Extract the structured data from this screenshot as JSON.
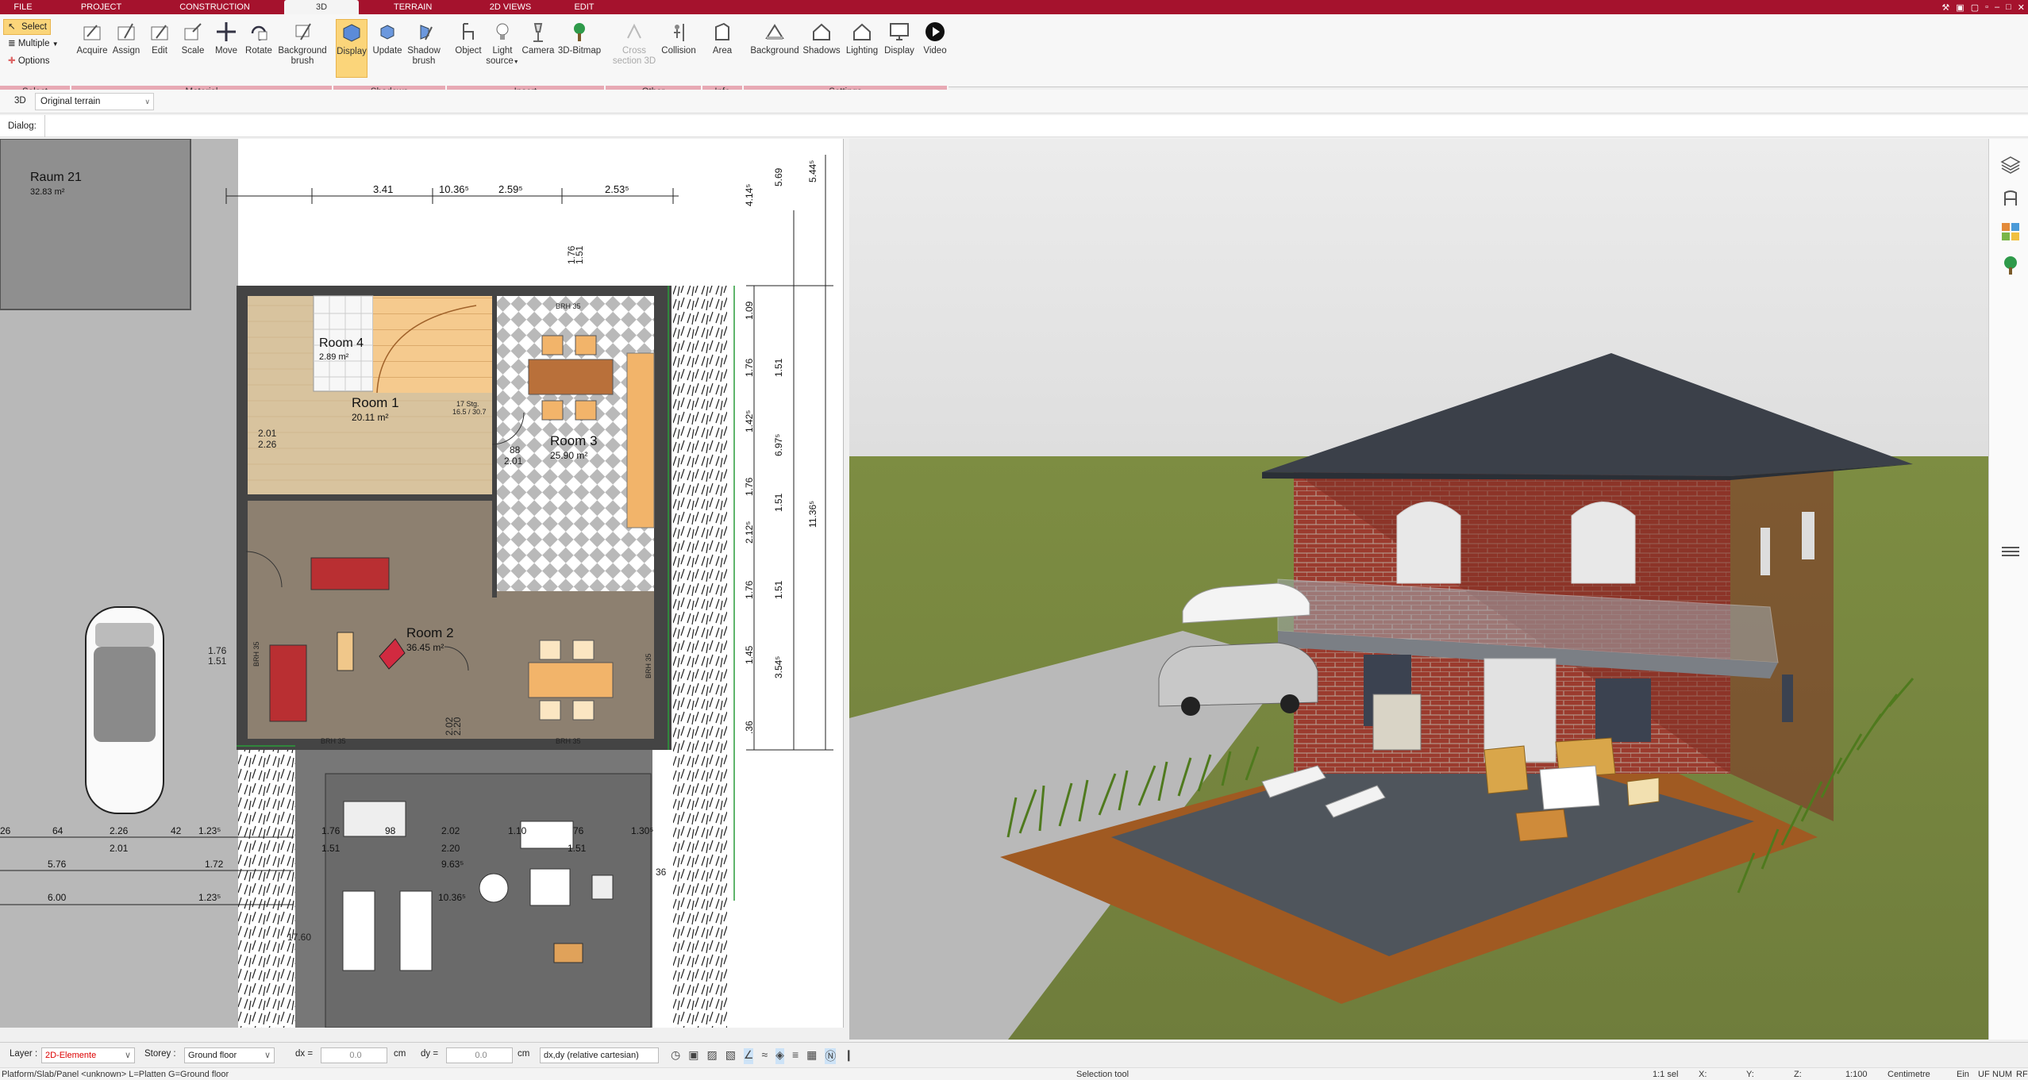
{
  "menubar": {
    "tabs": [
      {
        "label": "FILE"
      },
      {
        "label": "PROJECT"
      },
      {
        "label": "CONSTRUCTION"
      },
      {
        "label": "3D"
      },
      {
        "label": "TERRAIN"
      },
      {
        "label": "2D VIEWS"
      },
      {
        "label": "EDIT"
      }
    ],
    "active_tab": "3D",
    "colors": {
      "bar": "#a5122d",
      "group": "#e7a9b4",
      "active": "#fbd57a"
    }
  },
  "ribbon": {
    "select_group": {
      "select": "Select",
      "multiple": "Multiple",
      "options": "Options",
      "group_label": "Select"
    },
    "material": {
      "buttons": [
        "Acquire",
        "Assign",
        "Edit",
        "Scale",
        "Move",
        "Rotate",
        "Background",
        "brush"
      ],
      "group_label": "Material"
    },
    "shadows": {
      "buttons": [
        "Display",
        "Update",
        "Shadow",
        "brush"
      ],
      "group_label": "Shadows"
    },
    "insert": {
      "buttons": [
        "Object",
        "Light",
        "source",
        "Camera",
        "3D-Bitmap"
      ],
      "group_label": "Insert"
    },
    "other": {
      "buttons": [
        "Cross",
        "section 3D",
        "Collision"
      ],
      "group_label": "Other"
    },
    "info": {
      "buttons": [
        "Area"
      ],
      "group_label": "Info"
    },
    "settings": {
      "buttons": [
        "Background",
        "Shadows",
        "Lighting",
        "Display",
        "Video"
      ],
      "group_label": "Settings"
    }
  },
  "row2": {
    "view_label": "3D",
    "terrain_select": "Original terrain"
  },
  "row3": {
    "dialog_label": "Dialog:"
  },
  "plan": {
    "rooms": [
      {
        "name": "Raum 21",
        "area": "32.83 m²"
      },
      {
        "name": "Room 4",
        "area": "2.89 m²"
      },
      {
        "name": "Room 1",
        "area": "20.11 m²"
      },
      {
        "name": "Room 3",
        "area": "25.90 m²"
      },
      {
        "name": "Room 2",
        "area": "36.45 m²"
      }
    ],
    "top_dims": [
      "3.41",
      "10.36⁵",
      "2.59⁵",
      "2.53⁵"
    ],
    "right_dims_a": [
      "1.09",
      "1.76",
      "1.42⁵",
      "1.76",
      "2.12⁵",
      "1.76",
      "1.45",
      ".36"
    ],
    "right_dims_b": [
      "5.69",
      "1.51",
      "6.97⁵",
      "1.51",
      "1.51",
      "3.54⁵"
    ],
    "right_dims_c": [
      "5.44⁵",
      "11.36⁵",
      "4.14⁵"
    ],
    "bottom_row1": [
      "26",
      "64",
      "2.26",
      "42",
      "1.23⁵",
      "1.76",
      "98",
      "2.02",
      "1.10",
      "76",
      "1.30⁵"
    ],
    "bottom_row1_sub": [
      "2.01",
      "1.51",
      "2.20",
      "1.51"
    ],
    "bottom_row2": [
      "5.76",
      "1.72",
      "9.63⁵"
    ],
    "bottom_row3": [
      "6.00",
      "1.23⁵",
      "10.36⁵"
    ],
    "misc": [
      "BRH 35",
      "BRH 35",
      "BRH 35",
      "BRH 35",
      "BRH 35",
      "17.60",
      "2.01",
      "2.26",
      "1.76",
      "1.51",
      "2.01",
      "88",
      "17 Stg.",
      "16.5 / 30.7",
      "36",
      "1.51",
      "1.76",
      "2.02",
      "2.20"
    ]
  },
  "statusbar": {
    "layer_label": "Layer :",
    "layer_value": "2D-Elemente",
    "storey_label": "Storey :",
    "storey_value": "Ground floor",
    "dx_label": "dx =",
    "dx_value": "0.0",
    "dy_label": "dy =",
    "dy_value": "0.0",
    "unit": "cm",
    "unit2": "cm",
    "coord_mode": "dx,dy (relative cartesian)"
  },
  "footer": {
    "left": "Platform/Slab/Panel <unknown> L=Platten G=Ground floor",
    "tool": "Selection tool",
    "sel": "1:1 sel",
    "x": "X:",
    "y": "Y:",
    "z": "Z:",
    "scale": "1:100",
    "unit": "Centimetre",
    "ein": "Ein",
    "uf": "UF",
    "num": "NUM",
    "rf": "RF"
  }
}
